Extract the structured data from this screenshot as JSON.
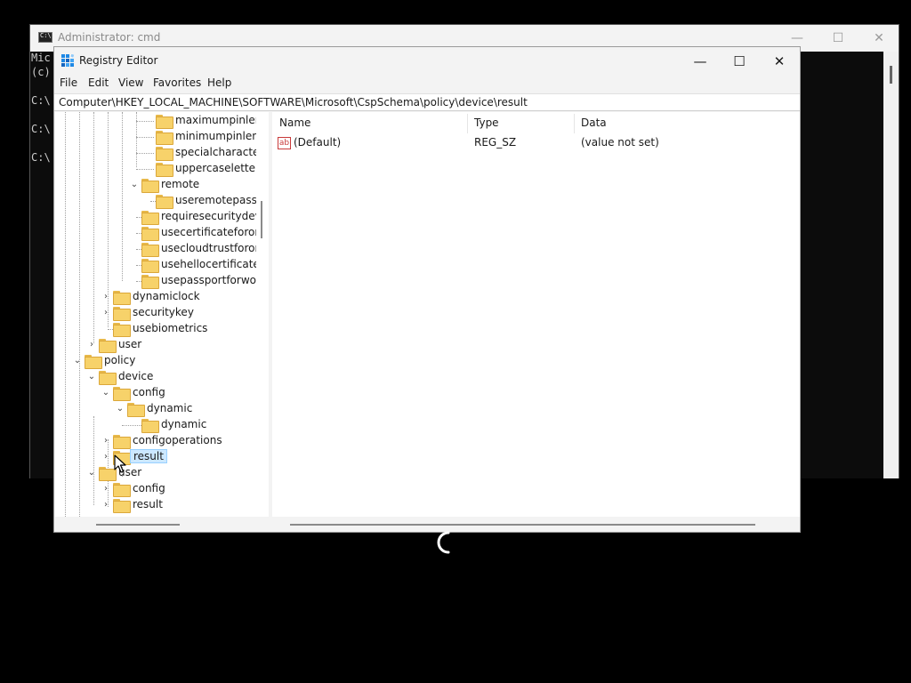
{
  "cmd": {
    "title": "Administrator: cmd",
    "lines": [
      "Mic",
      "(c)",
      "C:\\",
      "C:\\",
      "C:\\"
    ],
    "controls": {
      "minimize": "—",
      "maximize": "☐",
      "close": "✕"
    }
  },
  "regedit": {
    "title": "Registry Editor",
    "controls": {
      "minimize": "—",
      "maximize": "☐",
      "close": "✕"
    },
    "menu": [
      "File",
      "Edit",
      "View",
      "Favorites",
      "Help"
    ],
    "address": "Computer\\HKEY_LOCAL_MACHINE\\SOFTWARE\\Microsoft\\CspSchema\\policy\\device\\result",
    "tree": [
      {
        "label": "maximumpinlen",
        "expander": ""
      },
      {
        "label": "minimumpinlen",
        "expander": ""
      },
      {
        "label": "specialcharacters",
        "expander": ""
      },
      {
        "label": "uppercaseletters",
        "expander": ""
      },
      {
        "label": "remote",
        "expander": "expanded"
      },
      {
        "label": "useremotepassp",
        "expander": ""
      },
      {
        "label": "requiresecuritydevic",
        "expander": ""
      },
      {
        "label": "usecertificateforonp",
        "expander": ""
      },
      {
        "label": "usecloudtrustforonp",
        "expander": ""
      },
      {
        "label": "usehellocertificates",
        "expander": ""
      },
      {
        "label": "usepassportforwork",
        "expander": ""
      },
      {
        "label": "dynamiclock",
        "expander": "collapsed"
      },
      {
        "label": "securitykey",
        "expander": "collapsed"
      },
      {
        "label": "usebiometrics",
        "expander": ""
      },
      {
        "label": "user",
        "expander": "collapsed"
      },
      {
        "label": "policy",
        "expander": "expanded"
      },
      {
        "label": "device",
        "expander": "expanded"
      },
      {
        "label": "config",
        "expander": "expanded"
      },
      {
        "label": "dynamic",
        "expander": "expanded"
      },
      {
        "label": "dynamic",
        "expander": ""
      },
      {
        "label": "configoperations",
        "expander": "collapsed"
      },
      {
        "label": "result",
        "expander": "collapsed",
        "selected": true
      },
      {
        "label": "user",
        "expander": "expanded"
      },
      {
        "label": "config",
        "expander": "collapsed"
      },
      {
        "label": "result",
        "expander": "collapsed"
      }
    ],
    "columns": {
      "name": "Name",
      "type": "Type",
      "data": "Data"
    },
    "values": [
      {
        "icon": "ab",
        "name": "(Default)",
        "type": "REG_SZ",
        "data": "(value not set)"
      }
    ]
  },
  "colors": {
    "selection": "#cce8ff",
    "folder": "#f7d26a",
    "desktop": "#000000"
  }
}
